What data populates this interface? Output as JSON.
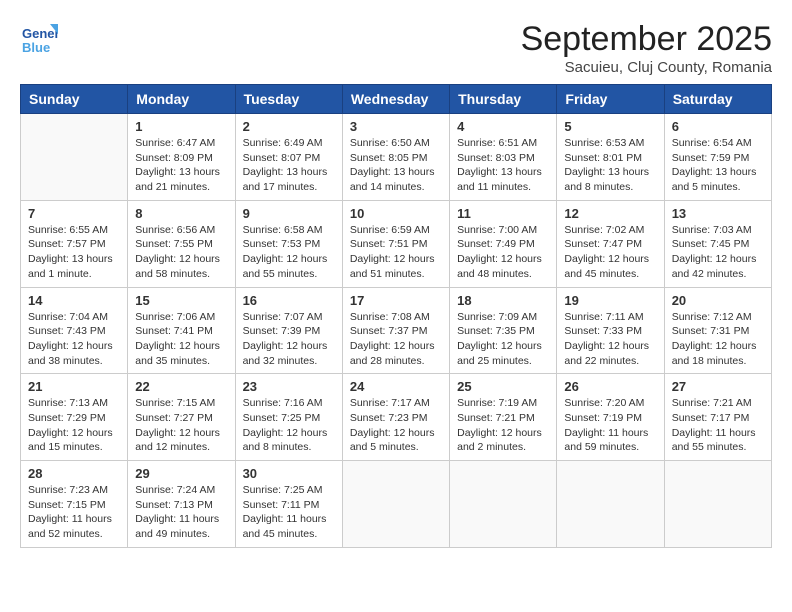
{
  "logo": {
    "line1": "General",
    "line2": "Blue"
  },
  "title": "September 2025",
  "location": "Sacuieu, Cluj County, Romania",
  "days_of_week": [
    "Sunday",
    "Monday",
    "Tuesday",
    "Wednesday",
    "Thursday",
    "Friday",
    "Saturday"
  ],
  "weeks": [
    [
      {
        "day": "",
        "info": ""
      },
      {
        "day": "1",
        "info": "Sunrise: 6:47 AM\nSunset: 8:09 PM\nDaylight: 13 hours\nand 21 minutes."
      },
      {
        "day": "2",
        "info": "Sunrise: 6:49 AM\nSunset: 8:07 PM\nDaylight: 13 hours\nand 17 minutes."
      },
      {
        "day": "3",
        "info": "Sunrise: 6:50 AM\nSunset: 8:05 PM\nDaylight: 13 hours\nand 14 minutes."
      },
      {
        "day": "4",
        "info": "Sunrise: 6:51 AM\nSunset: 8:03 PM\nDaylight: 13 hours\nand 11 minutes."
      },
      {
        "day": "5",
        "info": "Sunrise: 6:53 AM\nSunset: 8:01 PM\nDaylight: 13 hours\nand 8 minutes."
      },
      {
        "day": "6",
        "info": "Sunrise: 6:54 AM\nSunset: 7:59 PM\nDaylight: 13 hours\nand 5 minutes."
      }
    ],
    [
      {
        "day": "7",
        "info": "Sunrise: 6:55 AM\nSunset: 7:57 PM\nDaylight: 13 hours\nand 1 minute."
      },
      {
        "day": "8",
        "info": "Sunrise: 6:56 AM\nSunset: 7:55 PM\nDaylight: 12 hours\nand 58 minutes."
      },
      {
        "day": "9",
        "info": "Sunrise: 6:58 AM\nSunset: 7:53 PM\nDaylight: 12 hours\nand 55 minutes."
      },
      {
        "day": "10",
        "info": "Sunrise: 6:59 AM\nSunset: 7:51 PM\nDaylight: 12 hours\nand 51 minutes."
      },
      {
        "day": "11",
        "info": "Sunrise: 7:00 AM\nSunset: 7:49 PM\nDaylight: 12 hours\nand 48 minutes."
      },
      {
        "day": "12",
        "info": "Sunrise: 7:02 AM\nSunset: 7:47 PM\nDaylight: 12 hours\nand 45 minutes."
      },
      {
        "day": "13",
        "info": "Sunrise: 7:03 AM\nSunset: 7:45 PM\nDaylight: 12 hours\nand 42 minutes."
      }
    ],
    [
      {
        "day": "14",
        "info": "Sunrise: 7:04 AM\nSunset: 7:43 PM\nDaylight: 12 hours\nand 38 minutes."
      },
      {
        "day": "15",
        "info": "Sunrise: 7:06 AM\nSunset: 7:41 PM\nDaylight: 12 hours\nand 35 minutes."
      },
      {
        "day": "16",
        "info": "Sunrise: 7:07 AM\nSunset: 7:39 PM\nDaylight: 12 hours\nand 32 minutes."
      },
      {
        "day": "17",
        "info": "Sunrise: 7:08 AM\nSunset: 7:37 PM\nDaylight: 12 hours\nand 28 minutes."
      },
      {
        "day": "18",
        "info": "Sunrise: 7:09 AM\nSunset: 7:35 PM\nDaylight: 12 hours\nand 25 minutes."
      },
      {
        "day": "19",
        "info": "Sunrise: 7:11 AM\nSunset: 7:33 PM\nDaylight: 12 hours\nand 22 minutes."
      },
      {
        "day": "20",
        "info": "Sunrise: 7:12 AM\nSunset: 7:31 PM\nDaylight: 12 hours\nand 18 minutes."
      }
    ],
    [
      {
        "day": "21",
        "info": "Sunrise: 7:13 AM\nSunset: 7:29 PM\nDaylight: 12 hours\nand 15 minutes."
      },
      {
        "day": "22",
        "info": "Sunrise: 7:15 AM\nSunset: 7:27 PM\nDaylight: 12 hours\nand 12 minutes."
      },
      {
        "day": "23",
        "info": "Sunrise: 7:16 AM\nSunset: 7:25 PM\nDaylight: 12 hours\nand 8 minutes."
      },
      {
        "day": "24",
        "info": "Sunrise: 7:17 AM\nSunset: 7:23 PM\nDaylight: 12 hours\nand 5 minutes."
      },
      {
        "day": "25",
        "info": "Sunrise: 7:19 AM\nSunset: 7:21 PM\nDaylight: 12 hours\nand 2 minutes."
      },
      {
        "day": "26",
        "info": "Sunrise: 7:20 AM\nSunset: 7:19 PM\nDaylight: 11 hours\nand 59 minutes."
      },
      {
        "day": "27",
        "info": "Sunrise: 7:21 AM\nSunset: 7:17 PM\nDaylight: 11 hours\nand 55 minutes."
      }
    ],
    [
      {
        "day": "28",
        "info": "Sunrise: 7:23 AM\nSunset: 7:15 PM\nDaylight: 11 hours\nand 52 minutes."
      },
      {
        "day": "29",
        "info": "Sunrise: 7:24 AM\nSunset: 7:13 PM\nDaylight: 11 hours\nand 49 minutes."
      },
      {
        "day": "30",
        "info": "Sunrise: 7:25 AM\nSunset: 7:11 PM\nDaylight: 11 hours\nand 45 minutes."
      },
      {
        "day": "",
        "info": ""
      },
      {
        "day": "",
        "info": ""
      },
      {
        "day": "",
        "info": ""
      },
      {
        "day": "",
        "info": ""
      }
    ]
  ]
}
